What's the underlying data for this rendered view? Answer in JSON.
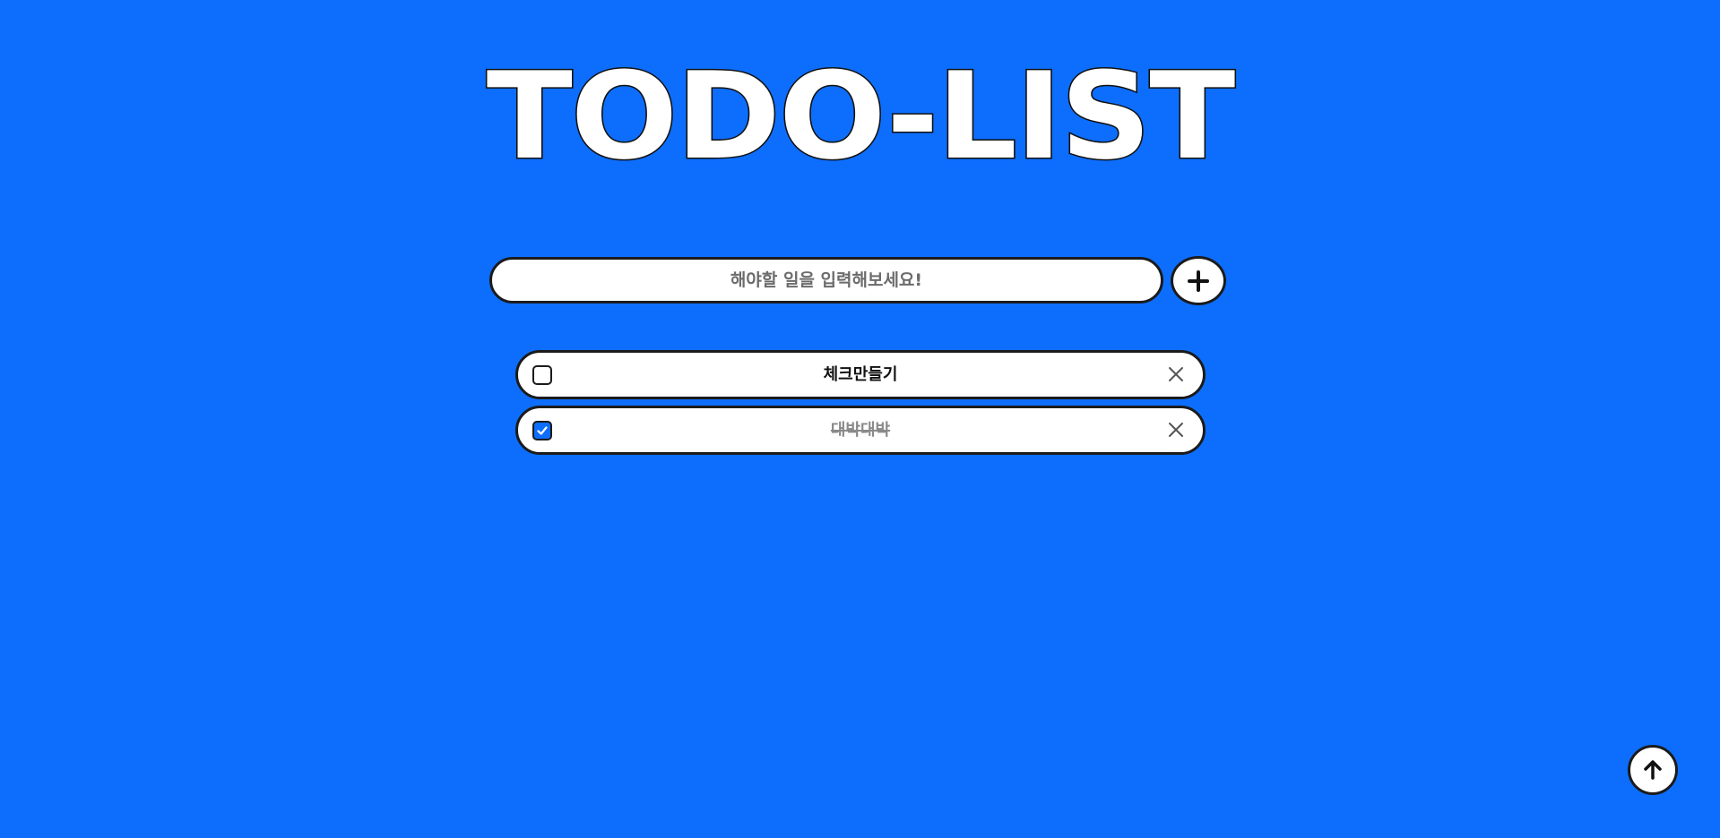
{
  "app": {
    "title": "TODO-LIST",
    "background_color": "#0d6efd"
  },
  "input": {
    "placeholder": "해야할 일을 입력해보세요!",
    "value": "",
    "add_icon": "plus-icon"
  },
  "todos": [
    {
      "text": "체크만들기",
      "checked": false,
      "delete_icon": "close-icon"
    },
    {
      "text": "대박대박",
      "checked": true,
      "delete_icon": "close-icon"
    }
  ],
  "scroll_top": {
    "icon": "arrow-up-icon"
  }
}
